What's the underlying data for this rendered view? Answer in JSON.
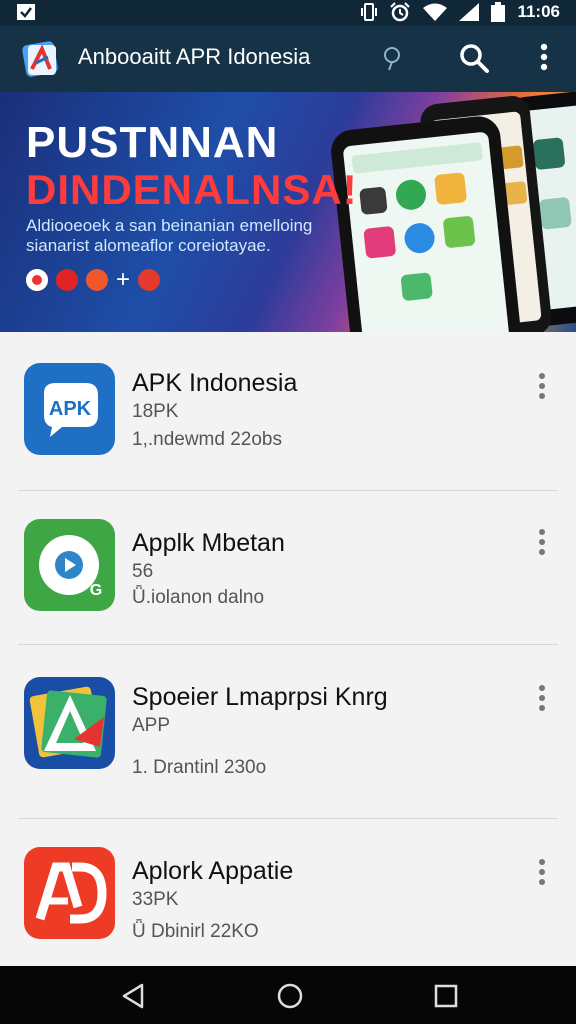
{
  "status_bar": {
    "time": "11:06",
    "icons": [
      "check-box-icon",
      "vibrate-icon",
      "alarm-icon",
      "wifi-icon",
      "signal-icon",
      "battery-icon"
    ]
  },
  "app_bar": {
    "title": "Anbooaitt APR Idonesia",
    "icons": [
      "app-logo-icon",
      "hint-icon",
      "search-icon",
      "more-vert-icon"
    ]
  },
  "banner": {
    "title_line1": "PUSTNNAN",
    "title_line2": "DINDENALNSA!",
    "subtitle": "Aldiooeoek a san beinanian emelloing sianarist alomeaflor coreiotayae.",
    "plus": "+"
  },
  "apps": [
    {
      "name": "APK Indonesia",
      "meta1": "18PK",
      "meta2": "1,.ndewmd 22obs",
      "icon": "apk-chat-icon",
      "color": "#1f6fc4"
    },
    {
      "name": "Applk Mbetan",
      "meta1": "56",
      "meta2": "Ǖ.iolanon dalno",
      "icon": "play-circle-icon",
      "color": "#3fa645"
    },
    {
      "name": "Spoeier Lmaprpsi Knrg",
      "meta1": "APP",
      "meta2": "1. Drantinl 230o",
      "icon": "triangle-logo-icon",
      "color": "#1a4ea6"
    },
    {
      "name": "Aplork Appatie",
      "meta1": "33PK",
      "meta2": "Ǖ Dbinirl 22KO",
      "icon": "ad-logo-icon",
      "color": "#ee3b25"
    }
  ],
  "nav_bar": {
    "icons": [
      "back-icon",
      "home-icon",
      "recents-icon"
    ]
  }
}
